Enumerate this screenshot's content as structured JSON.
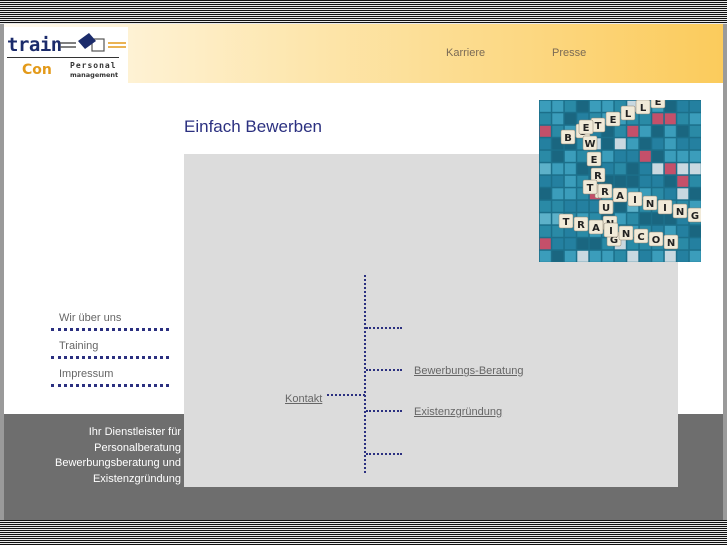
{
  "logo": {
    "train": "train",
    "con": "Con",
    "personal": "Personal",
    "management": "management"
  },
  "topnav": [
    {
      "label": "Karriere"
    },
    {
      "label": "Presse"
    }
  ],
  "page": {
    "title": "Einfach Bewerben"
  },
  "sidebar": {
    "items": [
      {
        "label": "Wir über uns"
      },
      {
        "label": "Training"
      },
      {
        "label": "Impressum"
      }
    ]
  },
  "tree": {
    "root": "Kontakt",
    "children": [
      {
        "label": ""
      },
      {
        "label": "Bewerbungs-Beratung"
      },
      {
        "label": "Existenzgründung"
      },
      {
        "label": ""
      }
    ]
  },
  "footer": {
    "lines": [
      "Ihr Dienstleister für",
      "Personalberatung",
      "Bewerbungsberatung und",
      "Existenzgründung"
    ]
  },
  "photo": {
    "tiles_h1": [
      "T",
      "R",
      "A",
      "I",
      "N",
      "I",
      "N",
      "G"
    ],
    "tiles_h2": [
      "T",
      "R",
      "A",
      "I",
      "N",
      "C",
      "O",
      "N"
    ],
    "tiles_top": [
      "B",
      "S",
      "T",
      "E",
      "L",
      "L",
      "E"
    ],
    "tiles_v": [
      "E",
      "W",
      "E",
      "R",
      "B",
      "U",
      "N",
      "G"
    ]
  },
  "colors": {
    "navy": "#2b3080",
    "orange": "#fbcb5c",
    "footer_gray": "#6e6e6e",
    "panel_gray": "#dcdcdc"
  }
}
